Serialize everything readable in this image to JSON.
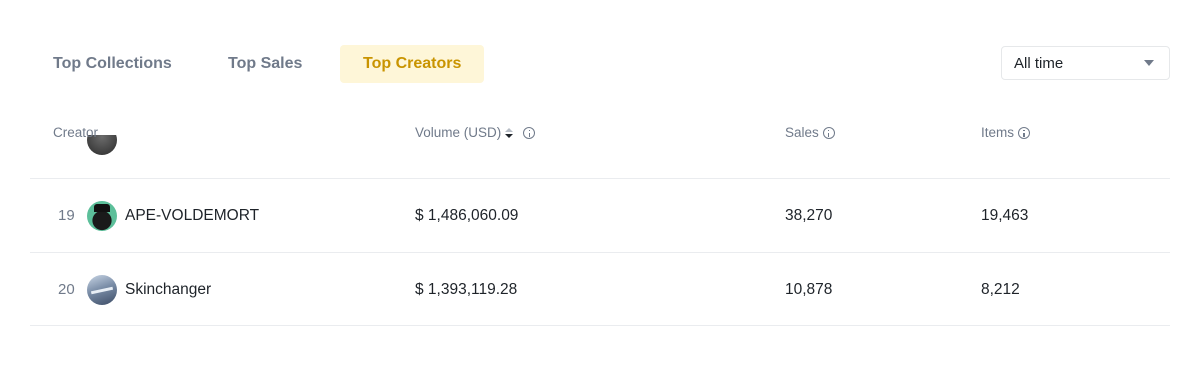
{
  "tabs": [
    {
      "label": "Top Collections",
      "active": false
    },
    {
      "label": "Top Sales",
      "active": false
    },
    {
      "label": "Top Creators",
      "active": true
    }
  ],
  "time_filter": {
    "selected": "All time"
  },
  "table": {
    "columns": {
      "creator": "Creator",
      "volume": "Volume (USD)",
      "sales": "Sales",
      "items": "Items"
    },
    "rows": [
      {
        "rank": "19",
        "name": "APE-VOLDEMORT",
        "volume": "$ 1,486,060.09",
        "sales": "38,270",
        "items": "19,463"
      },
      {
        "rank": "20",
        "name": "Skinchanger",
        "volume": "$ 1,393,119.28",
        "sales": "10,878",
        "items": "8,212"
      }
    ]
  },
  "colors": {
    "active_tab_bg": "#fef6d8",
    "active_tab_text": "#c99400",
    "muted_text": "#707a8a",
    "primary_text": "#1e2329"
  }
}
